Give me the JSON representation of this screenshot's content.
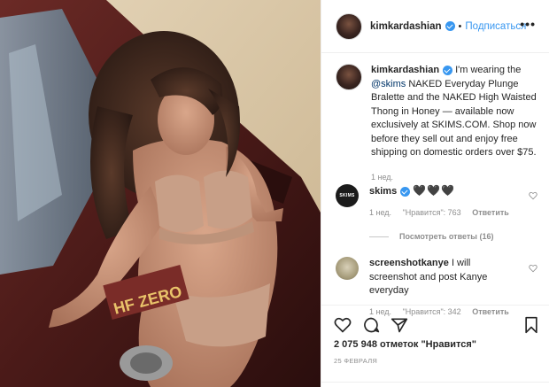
{
  "post": {
    "username": "kimkardashian",
    "dot": "•",
    "follow_label": "Подписаться",
    "more_icon": "•••",
    "plate_text": "HF ZERO"
  },
  "caption": {
    "username": "kimkardashian",
    "text_before": " I'm wearing the ",
    "mention": "@skims",
    "text_after": " NAKED Everyday Plunge Bralette and the NAKED High Waisted Thong in Honey — available now exclusively at SKIMS.COM. Shop now before they sell out and enjoy free shipping on domestic orders over $75.",
    "time": "1 нед."
  },
  "comments": [
    {
      "username": "skims",
      "avatar_text": "SKIMS",
      "text": "🖤🖤🖤",
      "time": "1 нед.",
      "likes": "\"Нравится\": 763",
      "reply": "Ответить"
    },
    {
      "username": "screenshotkanye",
      "text": " I will screenshot and post Kanye everyday",
      "time": "1 нед.",
      "likes": "\"Нравится\": 342",
      "reply": "Ответить"
    }
  ],
  "view_replies": "Посмотреть ответы (16)",
  "footer": {
    "likes": "2 075 948 отметок \"Нравится\"",
    "date": "25 ФЕВРАЛЯ"
  },
  "colors": {
    "link": "#3897f0",
    "mention": "#003569",
    "muted": "#8e8e8e",
    "text": "#262626"
  },
  "icons": [
    "heart-icon",
    "comment-icon",
    "share-icon",
    "bookmark-icon",
    "verified-badge-icon",
    "more-icon"
  ]
}
